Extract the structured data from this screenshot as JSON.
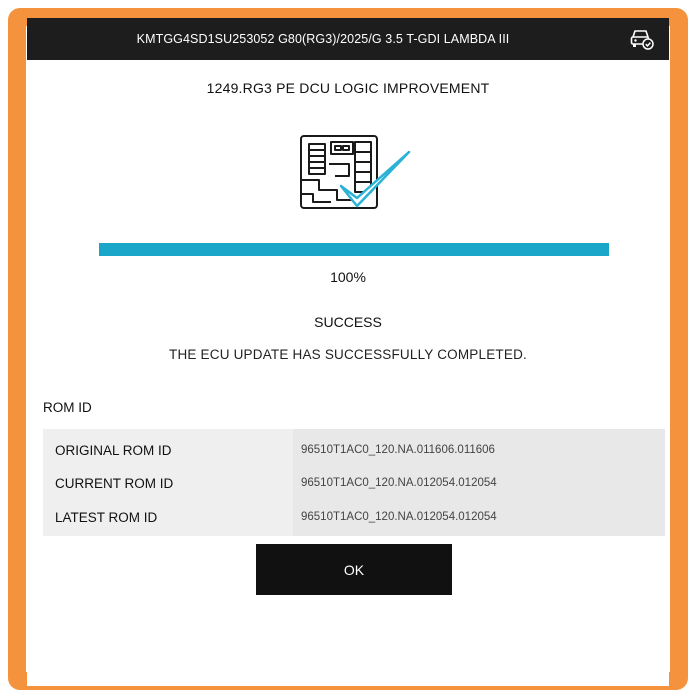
{
  "header": {
    "vehicle_info": "KMTGG4SD1SU253052  G80(RG3)/2025/G 3.5 T-GDI LAMBDA III",
    "icon": "vehicle-status-icon"
  },
  "update": {
    "title": "1249.RG3 PE DCU LOGIC IMPROVEMENT",
    "illustration_icon": "ecu-check-icon",
    "progress_percent": 100,
    "progress_label": "100%",
    "status_title": "SUCCESS",
    "status_message": "THE ECU UPDATE HAS SUCCESSFULLY COMPLETED."
  },
  "rom": {
    "heading": "ROM ID",
    "rows": [
      {
        "label": "ORIGINAL ROM ID",
        "value": "96510T1AC0_120.NA.011606.011606"
      },
      {
        "label": "CURRENT ROM ID",
        "value": "96510T1AC0_120.NA.012054.012054"
      },
      {
        "label": "LATEST ROM ID",
        "value": "96510T1AC0_120.NA.012054.012054"
      }
    ]
  },
  "actions": {
    "ok_label": "OK"
  },
  "colors": {
    "frame": "#f5923e",
    "topbar": "#1d1d1d",
    "progress": "#1aa6c9",
    "check": "#2ab3d6",
    "button": "#111111"
  }
}
